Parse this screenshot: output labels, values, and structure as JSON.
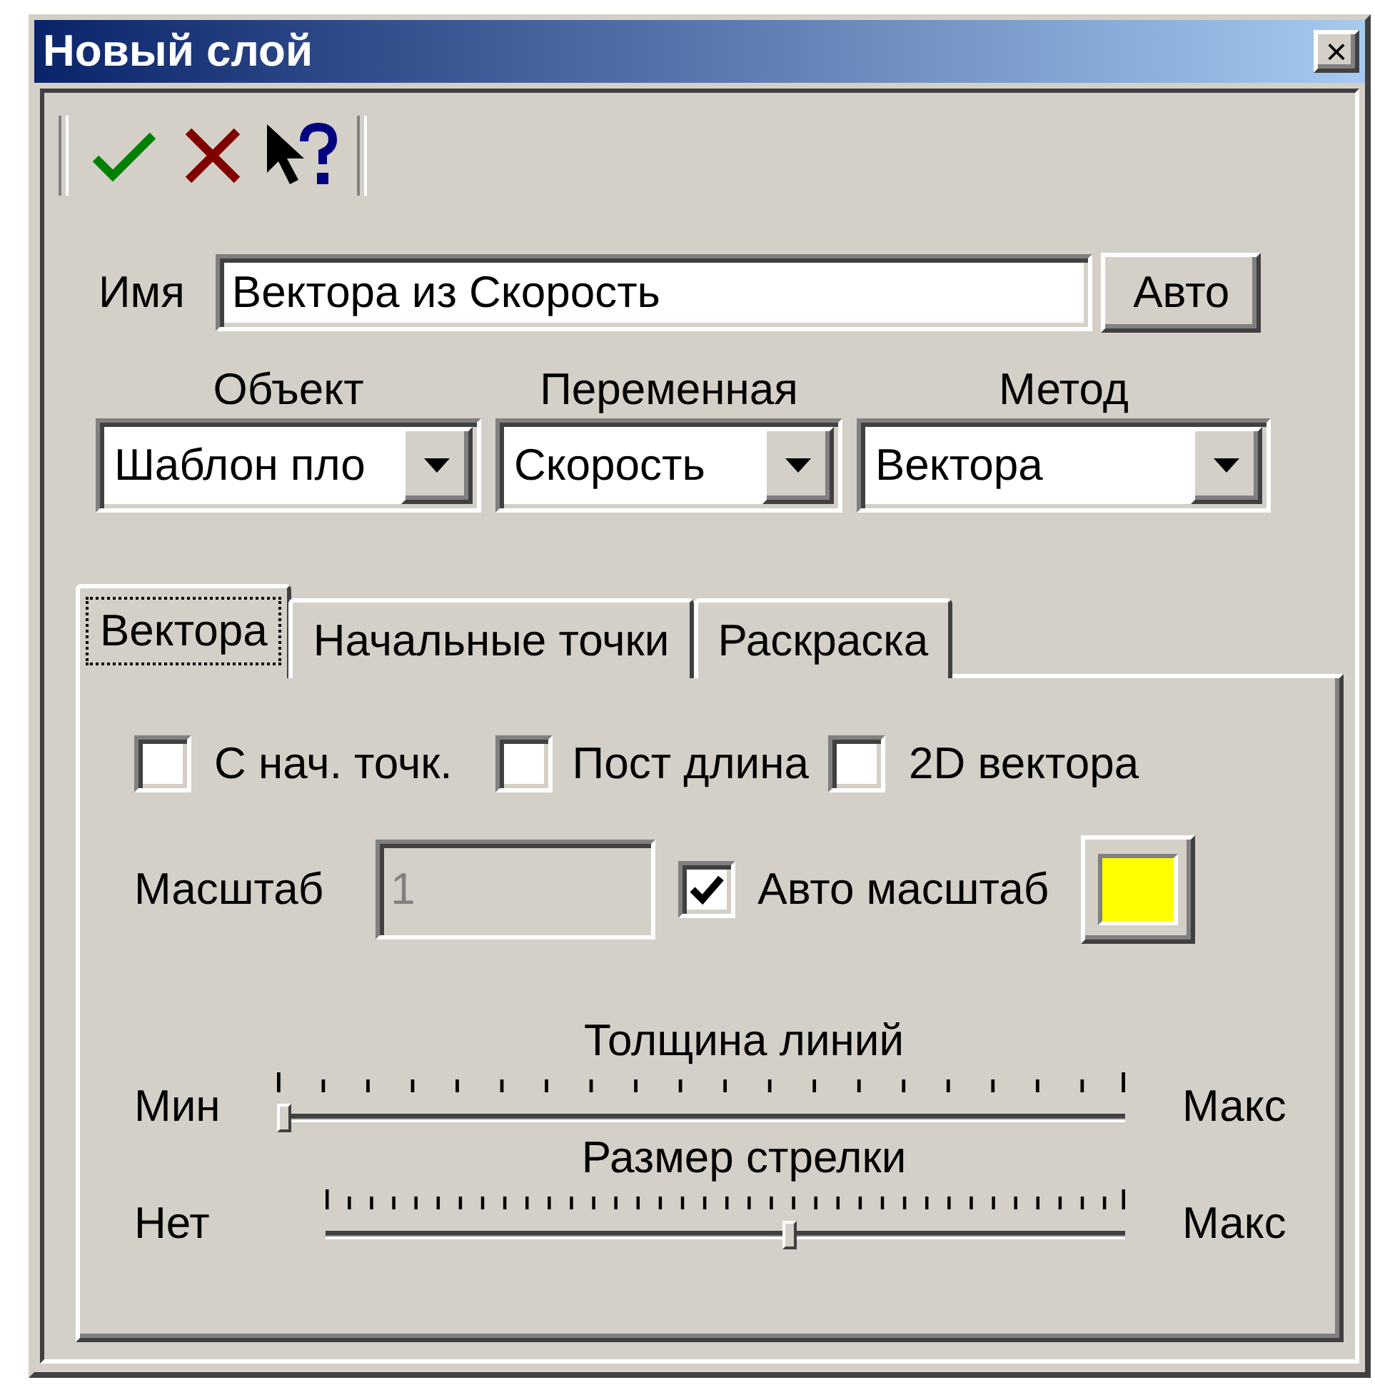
{
  "window": {
    "title": "Новый слой",
    "close": "×"
  },
  "toolbar": [
    {
      "kind": "ok"
    },
    {
      "kind": "cancel"
    },
    {
      "kind": "help"
    }
  ],
  "name": {
    "label": "Имя",
    "value": "Вектора из Скорость",
    "button": "Авто"
  },
  "combos": [
    {
      "label": "Объект",
      "value": "Шаблон пло"
    },
    {
      "label": "Переменная",
      "value": "Скорость"
    },
    {
      "label": "Метод",
      "value": "Вектора"
    }
  ],
  "tabs": [
    {
      "label": "Вектора",
      "selected": true
    },
    {
      "label": "Начальные точки",
      "selected": false
    },
    {
      "label": "Раскраска",
      "selected": false
    }
  ],
  "options": [
    {
      "label": "С нач. точк.",
      "checked": false
    },
    {
      "label": "Пост длина",
      "checked": false
    },
    {
      "label": "2D вектора",
      "checked": false
    }
  ],
  "scale": {
    "label": "Масштаб",
    "value": "1",
    "disabled": true
  },
  "auto_scale": {
    "label": "Авто масштаб",
    "checked": true
  },
  "vector_color": {
    "color": "#ffff00"
  },
  "sliders": [
    {
      "title": "Толщина линий",
      "min_label": "Мин",
      "max_label": "Макс",
      "level": 0.0
    },
    {
      "title": "Размер стрелки",
      "min_label": "Нет",
      "max_label": "Макс",
      "level": 0.58
    }
  ]
}
